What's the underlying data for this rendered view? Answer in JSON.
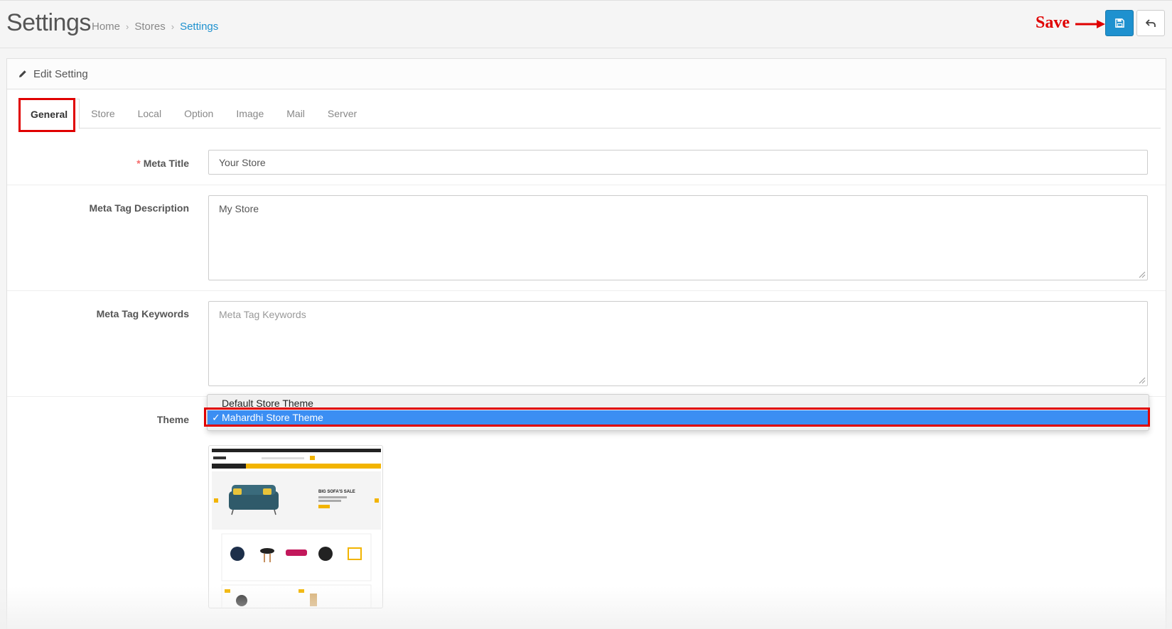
{
  "header": {
    "title": "Settings",
    "breadcrumb": [
      "Home",
      "Stores",
      "Settings"
    ],
    "save_annotation": "Save"
  },
  "panel": {
    "heading": "Edit Setting"
  },
  "tabs": [
    {
      "label": "General",
      "active": true
    },
    {
      "label": "Store"
    },
    {
      "label": "Local"
    },
    {
      "label": "Option"
    },
    {
      "label": "Image"
    },
    {
      "label": "Mail"
    },
    {
      "label": "Server"
    }
  ],
  "form": {
    "meta_title": {
      "label": "Meta Title",
      "required_mark": "*",
      "value": "Your Store"
    },
    "meta_description": {
      "label": "Meta Tag Description",
      "value": "My Store"
    },
    "meta_keywords": {
      "label": "Meta Tag Keywords",
      "placeholder": "Meta Tag Keywords"
    },
    "theme": {
      "label": "Theme",
      "options": [
        "Default Store Theme",
        "Mahardhi Store Theme"
      ],
      "selected": "Mahardhi Store Theme",
      "check_mark": "✓"
    }
  },
  "preview_banner": "BIG SOFA'S SALE",
  "colors": {
    "primary": "#1e91cf",
    "annotation_red": "#e00000",
    "dropdown_selected": "#3b8ef3",
    "theme_accent": "#f2b400"
  }
}
